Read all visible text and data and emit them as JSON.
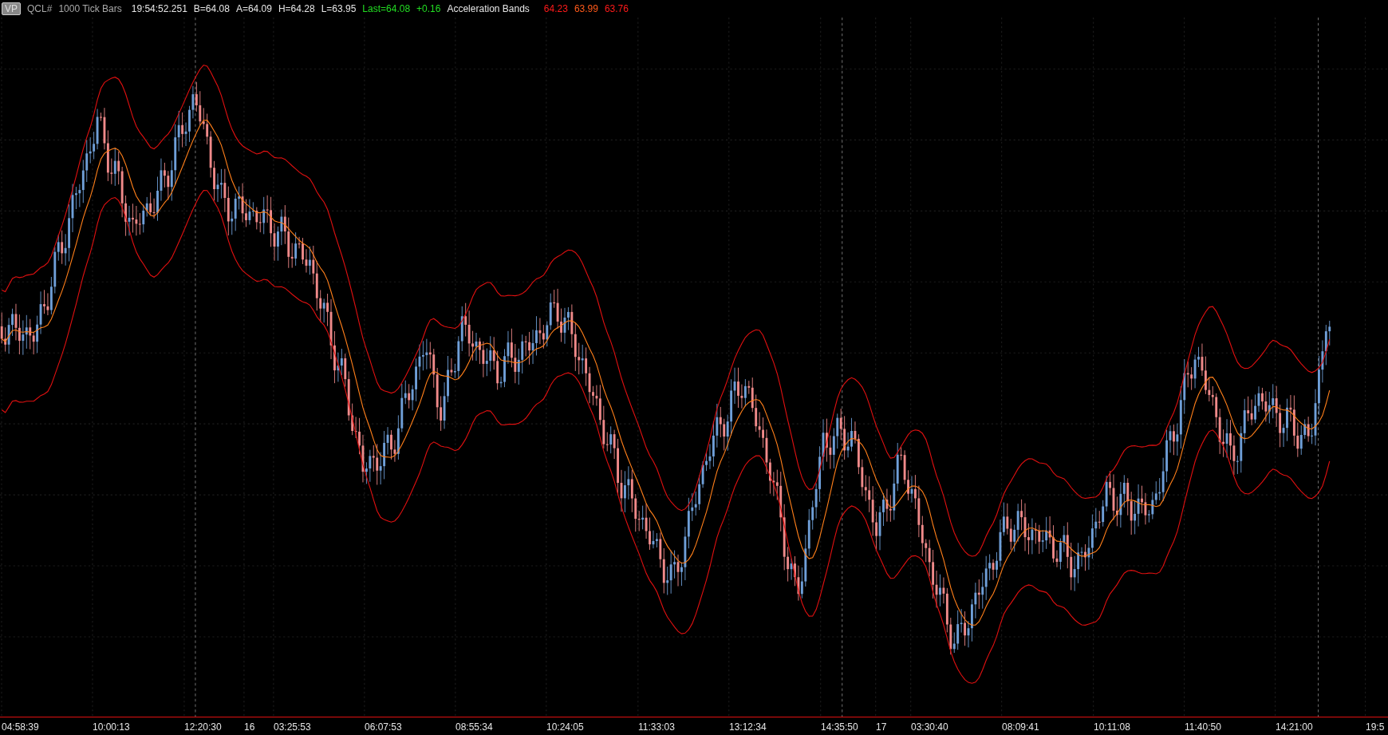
{
  "header": {
    "badge": "VP",
    "symbol": "QCL#",
    "bar_type": "1000 Tick Bars",
    "time": "19:54:52.251",
    "bid": "B=64.08",
    "ask": "A=64.09",
    "high": "H=64.28",
    "low": "L=63.95",
    "last": "Last=64.08",
    "change": "+0.16",
    "indicator": "Acceleration Bands",
    "indicator_values": [
      {
        "text": "64.23",
        "color": "#ff1a1a"
      },
      {
        "text": "63.99",
        "color": "#ff5a1a"
      },
      {
        "text": "63.76",
        "color": "#ff1a1a"
      }
    ]
  },
  "time_axis": {
    "labels": [
      "04:58:39",
      "10:00:13",
      "12:20:30",
      "16",
      "03:25:53",
      "06:07:53",
      "08:55:34",
      "10:24:05",
      "11:33:03",
      "13:12:34",
      "14:35:50",
      "17",
      "03:30:40",
      "08:09:41",
      "10:11:08",
      "11:40:50",
      "14:21:00",
      "19:5"
    ]
  }
}
